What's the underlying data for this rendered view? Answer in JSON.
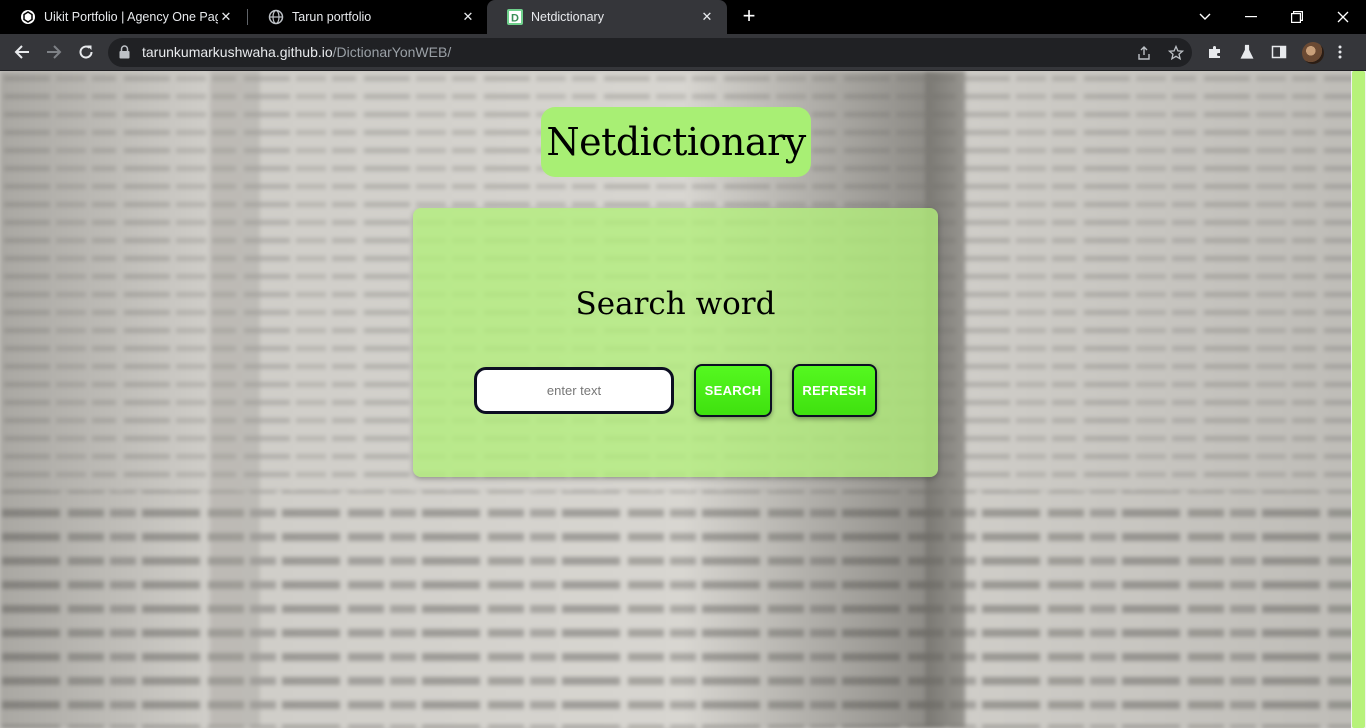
{
  "browser": {
    "tabs": [
      {
        "title": "Uikit Portfolio | Agency One Page",
        "active": false,
        "favicon": "uikit-logo-icon"
      },
      {
        "title": "Tarun portfolio",
        "active": false,
        "favicon": "globe-icon"
      },
      {
        "title": "Netdictionary",
        "active": true,
        "favicon": "letter-d-icon"
      }
    ],
    "new_tab_label": "+",
    "url_host": "tarunkumarkushwaha.github.io",
    "url_path": "/DictionarYonWEB/"
  },
  "page": {
    "brand_title": "Netdictionary",
    "card_title": "Search word",
    "search_placeholder": "enter text",
    "search_button": "SEARCH",
    "refresh_button": "REFRESH"
  },
  "colors": {
    "accent_green": "#a8ef74",
    "button_green": "#4aeb18",
    "border_dark": "#0c0e22",
    "tab_active": "#35363a"
  }
}
